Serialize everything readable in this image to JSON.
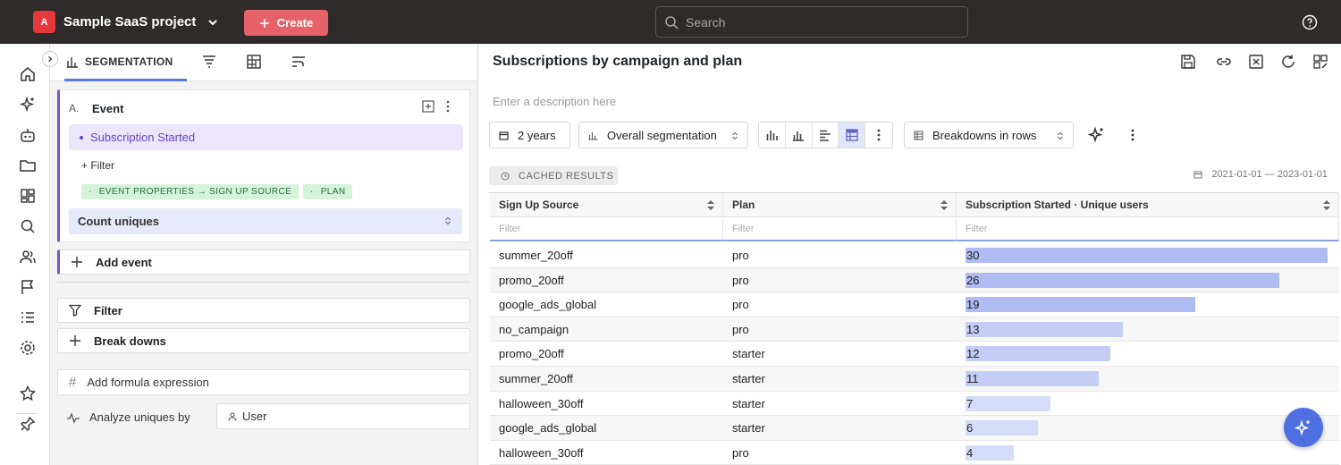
{
  "topbar": {
    "project_badge": "A",
    "project_name": "Sample SaaS project",
    "create_label": "Create",
    "search_placeholder": "Search"
  },
  "left_nav": {
    "icons": [
      "home-icon",
      "sparkle-icon",
      "bot-icon",
      "folder-icon",
      "dashboard-icon",
      "search-icon",
      "users-icon",
      "flag-icon",
      "list-icon",
      "gear-icon",
      "star-icon",
      "pin-icon"
    ]
  },
  "query_panel": {
    "active_tab": "SEGMENTATION",
    "event_letter": "A.",
    "event_title": "Event",
    "event_name": "Subscription Started",
    "add_filter": "+ Filter",
    "chips": [
      "EVENT PROPERTIES → SIGN UP SOURCE",
      "PLAN"
    ],
    "measure": "Count uniques",
    "add_event": "Add event",
    "filter": "Filter",
    "breakdowns": "Break downs",
    "add_formula": "Add formula expression",
    "analyze_label": "Analyze uniques by",
    "analyze_value": "User"
  },
  "report": {
    "title": "Subscriptions by campaign and plan",
    "description_placeholder": "Enter a description here",
    "range": "2 years",
    "segmentation": "Overall segmentation",
    "breakdown_mode": "Breakdowns in rows",
    "cached": "CACHED RESULTS",
    "date_range": "2021-01-01 — 2023-01-01"
  },
  "table": {
    "headers": [
      "Sign Up Source",
      "Plan",
      "Subscription Started · Unique users"
    ],
    "filter_placeholder": "Filter",
    "rows": [
      {
        "source": "summer_20off",
        "plan": "pro",
        "value": "30"
      },
      {
        "source": "promo_20off",
        "plan": "pro",
        "value": "26"
      },
      {
        "source": "google_ads_global",
        "plan": "pro",
        "value": "19"
      },
      {
        "source": "no_campaign",
        "plan": "pro",
        "value": "13"
      },
      {
        "source": "promo_20off",
        "plan": "starter",
        "value": "12"
      },
      {
        "source": "summer_20off",
        "plan": "starter",
        "value": "11"
      },
      {
        "source": "halloween_30off",
        "plan": "starter",
        "value": "7"
      },
      {
        "source": "google_ads_global",
        "plan": "starter",
        "value": "6"
      },
      {
        "source": "halloween_30off",
        "plan": "pro",
        "value": "4"
      }
    ],
    "max_value": 30
  }
}
